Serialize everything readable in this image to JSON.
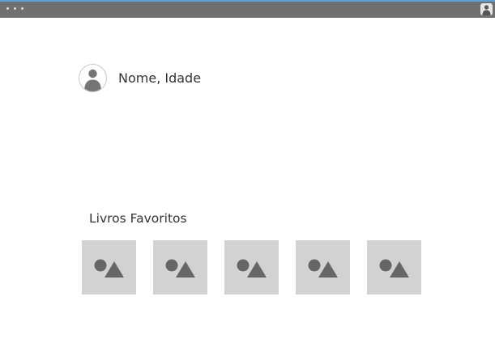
{
  "window": {
    "accent_color": "#5aa3de",
    "titlebar_color": "#707070",
    "menu_icon": "three-dots-icon",
    "account_icon": "user-icon"
  },
  "profile": {
    "avatar_icon": "user-avatar-icon",
    "name_age": "Nome, Idade"
  },
  "favorites": {
    "title": "Livros Favoritos",
    "items": [
      {
        "icon": "image-placeholder-icon"
      },
      {
        "icon": "image-placeholder-icon"
      },
      {
        "icon": "image-placeholder-icon"
      },
      {
        "icon": "image-placeholder-icon"
      },
      {
        "icon": "image-placeholder-icon"
      }
    ]
  }
}
